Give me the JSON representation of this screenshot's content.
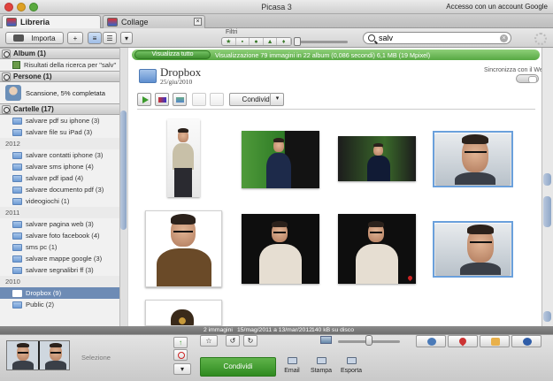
{
  "window": {
    "title": "Picasa 3",
    "account_text": "Accesso con un account Google"
  },
  "tabs": [
    {
      "label": "Libreria"
    },
    {
      "label": "Collage"
    }
  ],
  "toolbar": {
    "import_label": "Importa",
    "filters_label": "Filtri"
  },
  "search": {
    "value": "salv",
    "placeholder": ""
  },
  "sidebar": {
    "album_section": "Album (1)",
    "album_items": [
      "Risultati della ricerca per \"salv\""
    ],
    "people_section": "Persone (1)",
    "people_status": "Scansione, 5% completata",
    "folders_section": "Cartelle (17)",
    "groups": [
      {
        "year": "",
        "items": [
          "salvare pdf su iphone (3)",
          "salvare file su iPad (3)"
        ]
      },
      {
        "year": "2012",
        "items": [
          "salvare contatti iphone (3)",
          "salvare sms iphone (4)",
          "salvare pdf ipad (4)",
          "salvare documento pdf (3)",
          "videogiochi (1)"
        ]
      },
      {
        "year": "2011",
        "items": [
          "salvare pagina web (3)",
          "salvare foto facebook (4)",
          "sms pc (1)",
          "salvare mappe google (3)",
          "salvare segnalibri ff (3)"
        ]
      },
      {
        "year": "2010",
        "items": [
          "Dropbox (9)",
          "Public (2)"
        ]
      }
    ],
    "selected_item": "Dropbox (9)"
  },
  "banner": {
    "view_all": "Visualizza tutto",
    "text": "Visualizzazione 79 immagini in 22 album (0,086 secondi) 6,1 MB (19 Mpixel)"
  },
  "folder": {
    "name": "Dropbox",
    "date": "25/giu/2010",
    "sync_label": "Sincronizza con il Web"
  },
  "actions": {
    "share_label": "Condividi"
  },
  "status": {
    "count": "2 immagini",
    "date_range": "15/mag/2011 a 13/mar/2012",
    "size": "140 kB su disco"
  },
  "tray": {
    "selection_label": "Selezione",
    "share_button": "Condividi",
    "email": "Email",
    "print": "Stampa",
    "export": "Esporta"
  },
  "colors": {
    "accent_green": "#57a843",
    "selection_blue": "#6d8bb5"
  }
}
